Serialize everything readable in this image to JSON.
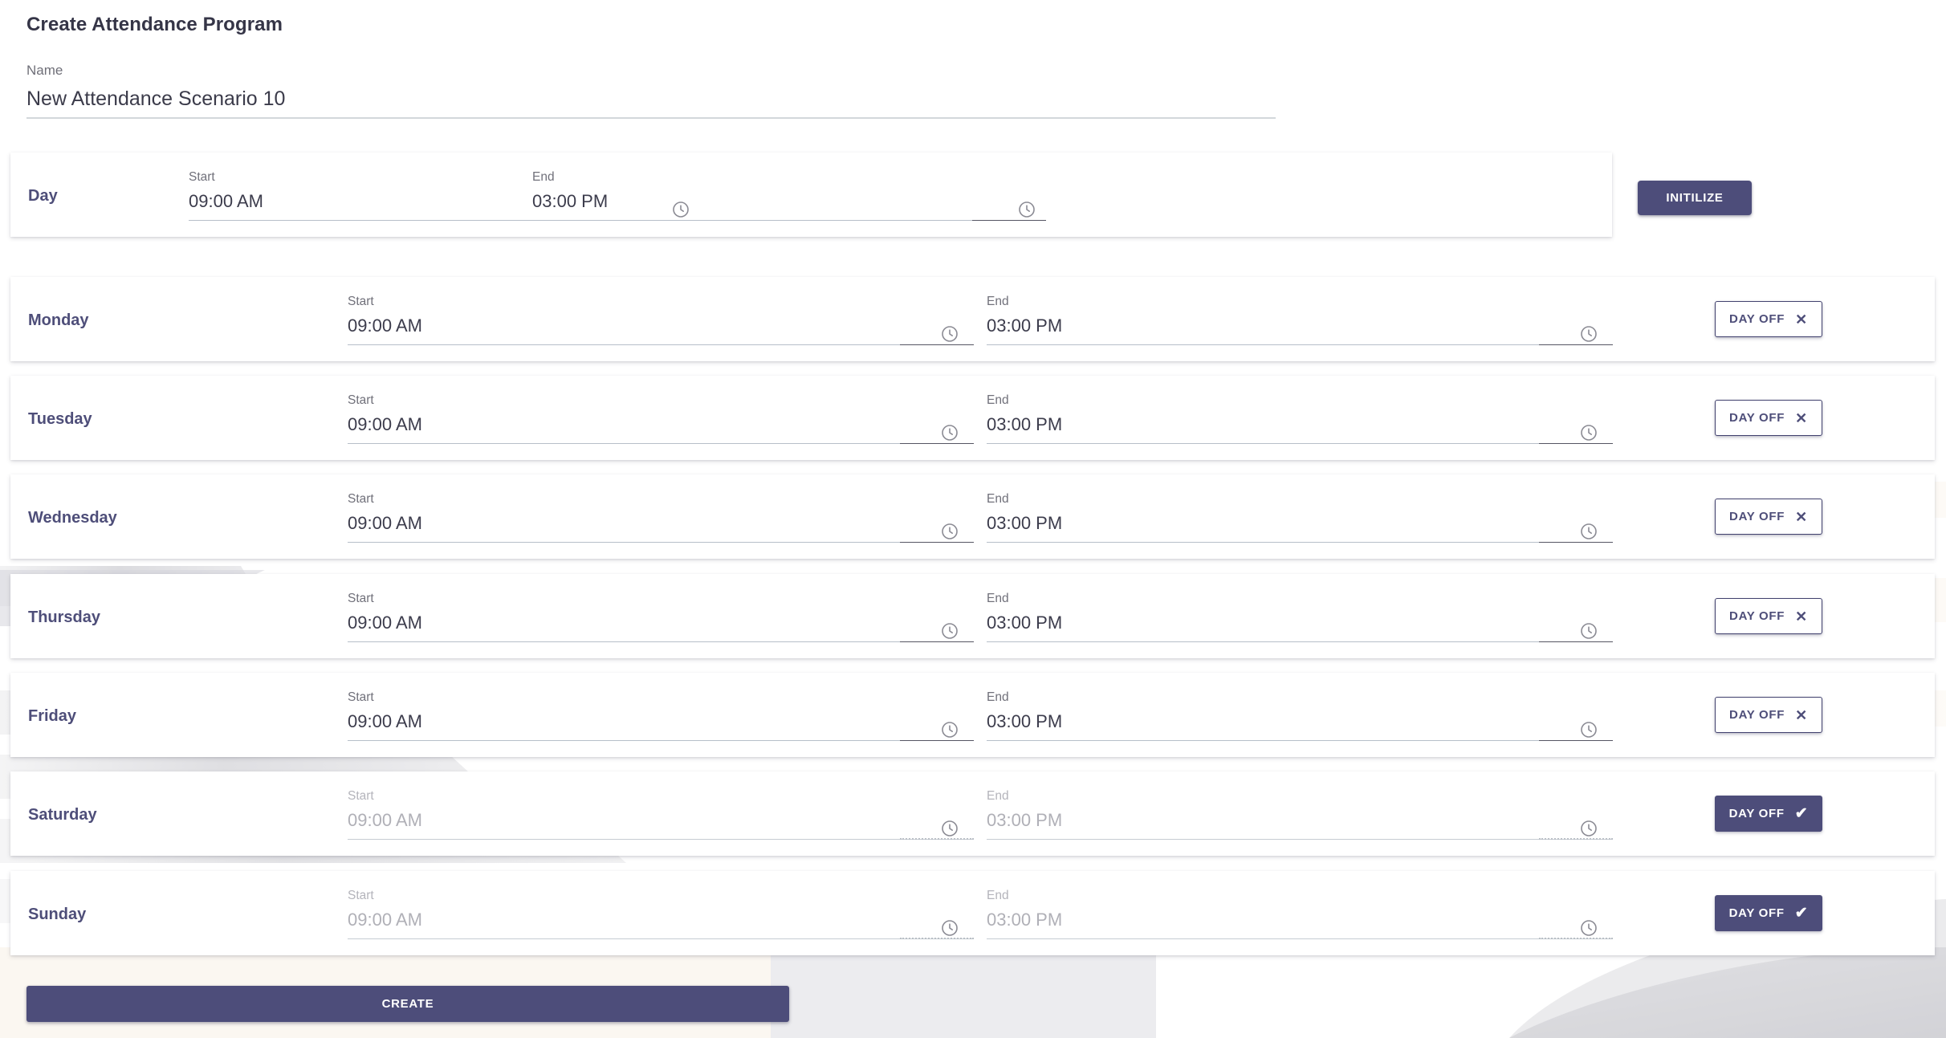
{
  "page": {
    "title": "Create Attendance Program"
  },
  "name_field": {
    "label": "Name",
    "value": "New Attendance Scenario 10",
    "placeholder": "Name"
  },
  "labels": {
    "start": "Start",
    "end": "End",
    "day_off": "DAY OFF"
  },
  "icons": {
    "clock": "clock-icon",
    "cross": "✕",
    "check": "✔"
  },
  "colors": {
    "accent": "#4d4d7a",
    "day_label": "#4e4e79",
    "title": "#353547",
    "muted": "#70707a",
    "disabled_text": "#b0b0b7",
    "underline": "#b7bfc9"
  },
  "template_row": {
    "day": "Day",
    "start": "09:00 AM",
    "end": "03:00 PM",
    "initialize_label": "INITILIZE"
  },
  "rows": [
    {
      "day": "Monday",
      "start": "09:00 AM",
      "end": "03:00 PM",
      "day_off": false,
      "disabled": false
    },
    {
      "day": "Tuesday",
      "start": "09:00 AM",
      "end": "03:00 PM",
      "day_off": false,
      "disabled": false
    },
    {
      "day": "Wednesday",
      "start": "09:00 AM",
      "end": "03:00 PM",
      "day_off": false,
      "disabled": false
    },
    {
      "day": "Thursday",
      "start": "09:00 AM",
      "end": "03:00 PM",
      "day_off": false,
      "disabled": false
    },
    {
      "day": "Friday",
      "start": "09:00 AM",
      "end": "03:00 PM",
      "day_off": false,
      "disabled": false
    },
    {
      "day": "Saturday",
      "start": "09:00 AM",
      "end": "03:00 PM",
      "day_off": true,
      "disabled": true
    },
    {
      "day": "Sunday",
      "start": "09:00 AM",
      "end": "03:00 PM",
      "day_off": true,
      "disabled": true
    }
  ],
  "footer": {
    "create_label": "CREATE"
  }
}
